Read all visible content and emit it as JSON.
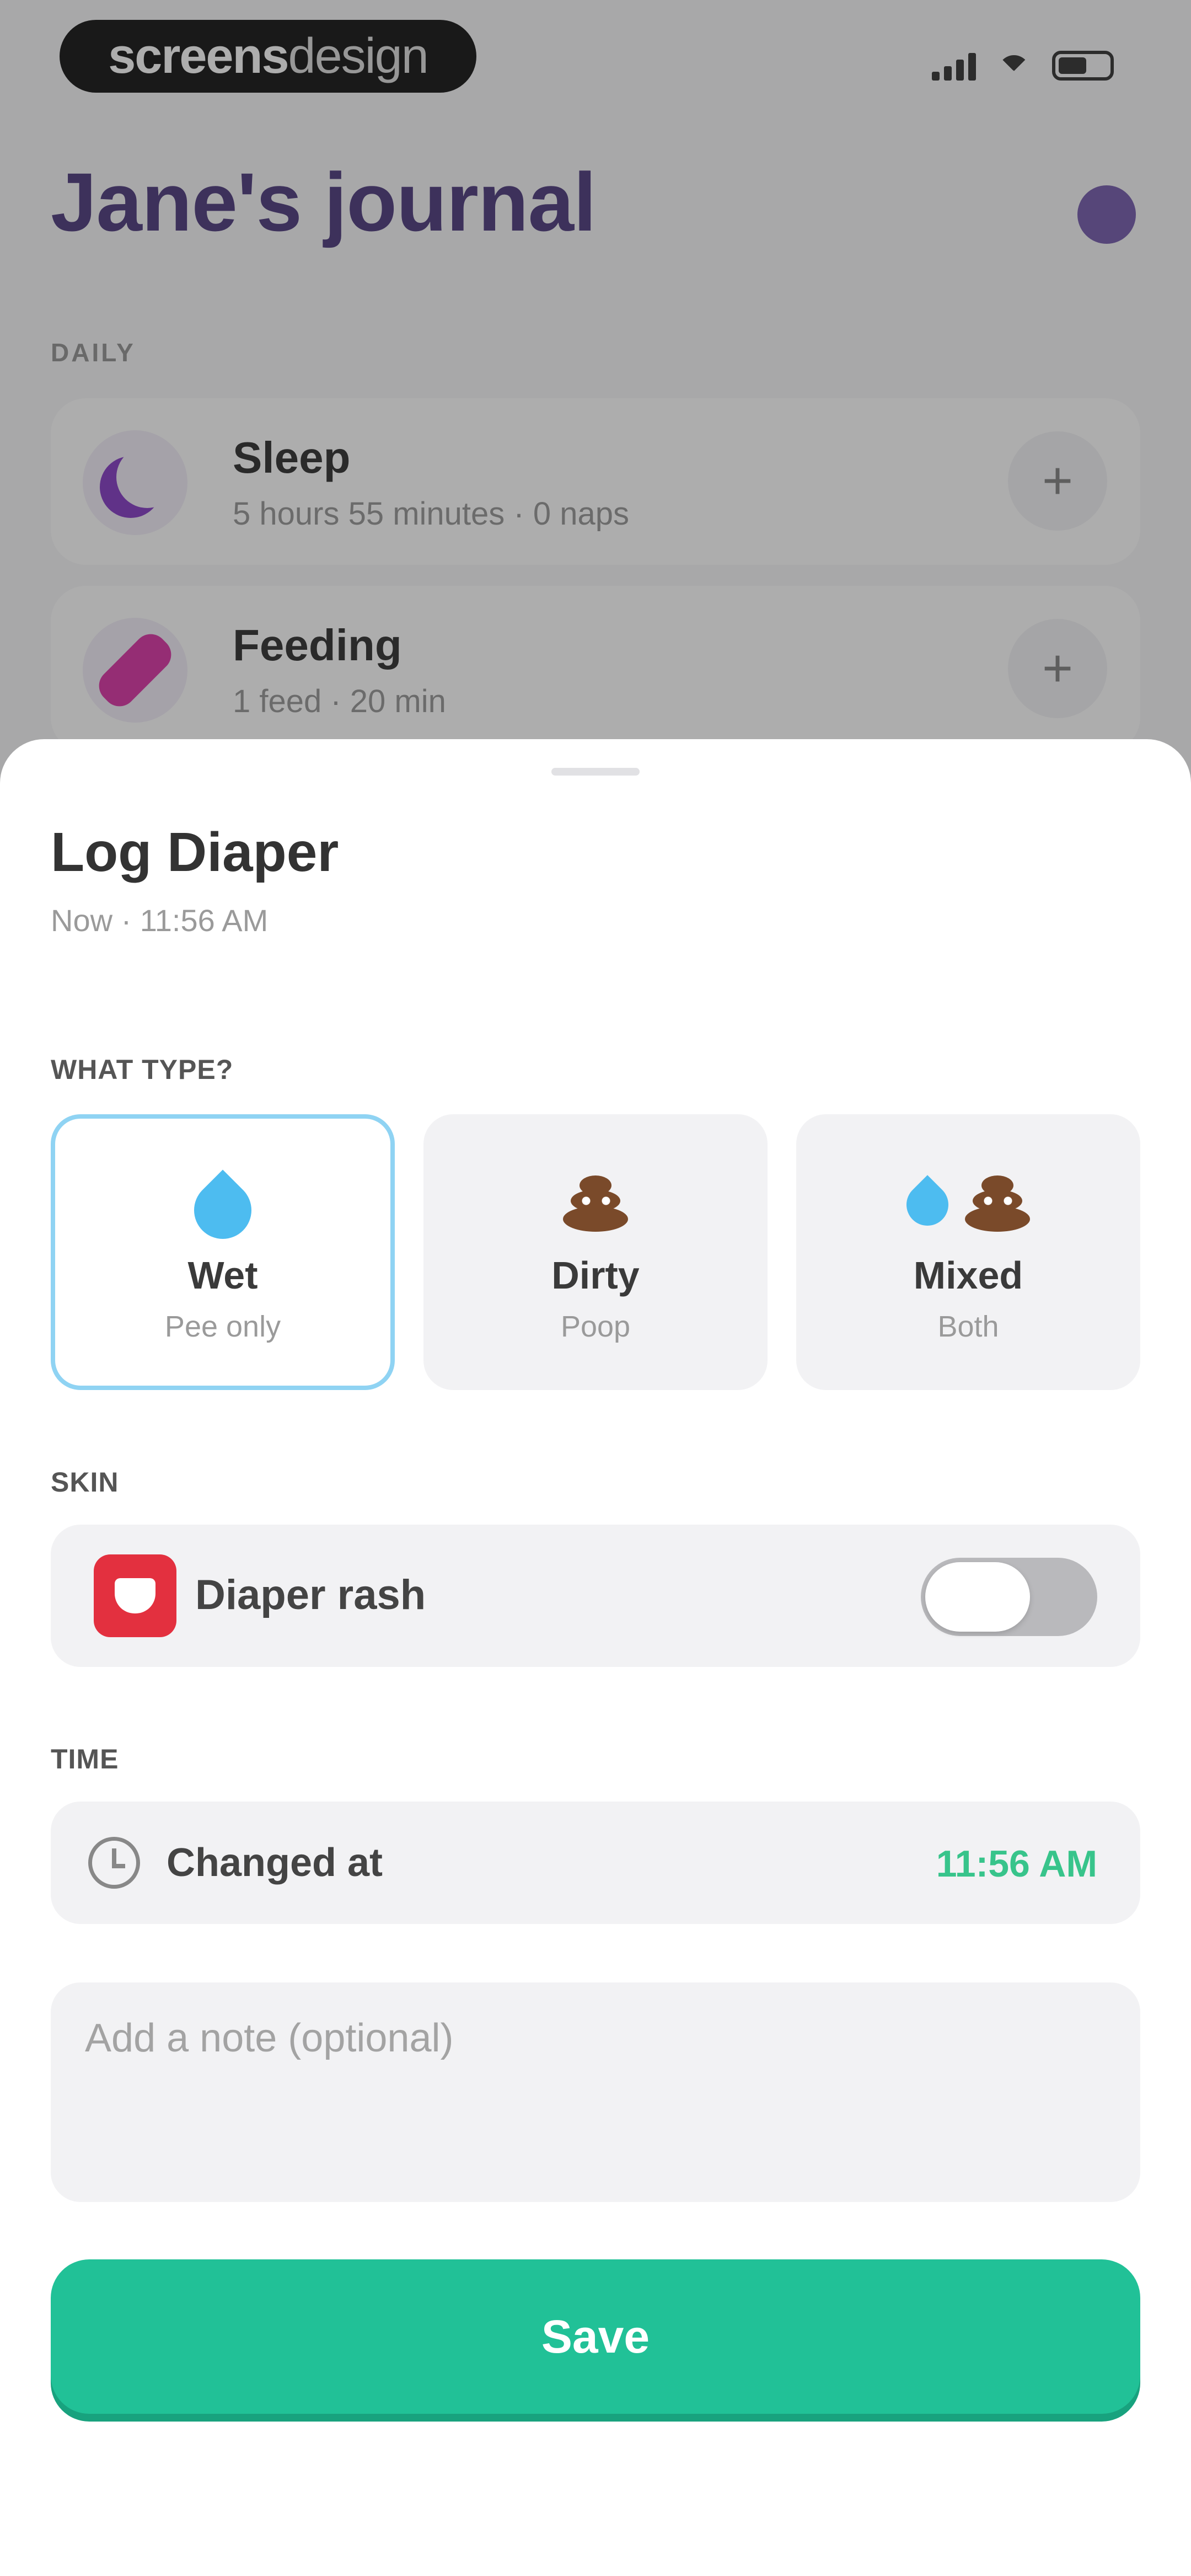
{
  "status_bar": {
    "brand_bold": "screens",
    "brand_light": "design"
  },
  "journal": {
    "title": "Jane's journal",
    "section_label": "DAILY",
    "cards": [
      {
        "title": "Sleep",
        "subtitle": "5 hours 55 minutes · 0 naps",
        "icon": "moon-icon"
      },
      {
        "title": "Feeding",
        "subtitle": "1 feed · 20 min",
        "icon": "bottle-icon"
      }
    ],
    "add_symbol": "+"
  },
  "sheet": {
    "title": "Log Diaper",
    "subtitle": "Now · 11:56 AM",
    "type_label": "WHAT TYPE?",
    "types": [
      {
        "name": "Wet",
        "desc": "Pee only",
        "selected": true
      },
      {
        "name": "Dirty",
        "desc": "Poop",
        "selected": false
      },
      {
        "name": "Mixed",
        "desc": "Both",
        "selected": false
      }
    ],
    "skin_label": "SKIN",
    "rash_label": "Diaper rash",
    "rash_enabled": false,
    "time_label": "TIME",
    "changed_at_label": "Changed at",
    "changed_at_value": "11:56 AM",
    "note_placeholder": "Add a note (optional)",
    "save_label": "Save"
  },
  "colors": {
    "accent_green": "#21c197",
    "time_green": "#38c48b",
    "selected_border": "#8fd3f3",
    "title_purple": "#3f2a73",
    "rash_red": "#e3303f"
  }
}
